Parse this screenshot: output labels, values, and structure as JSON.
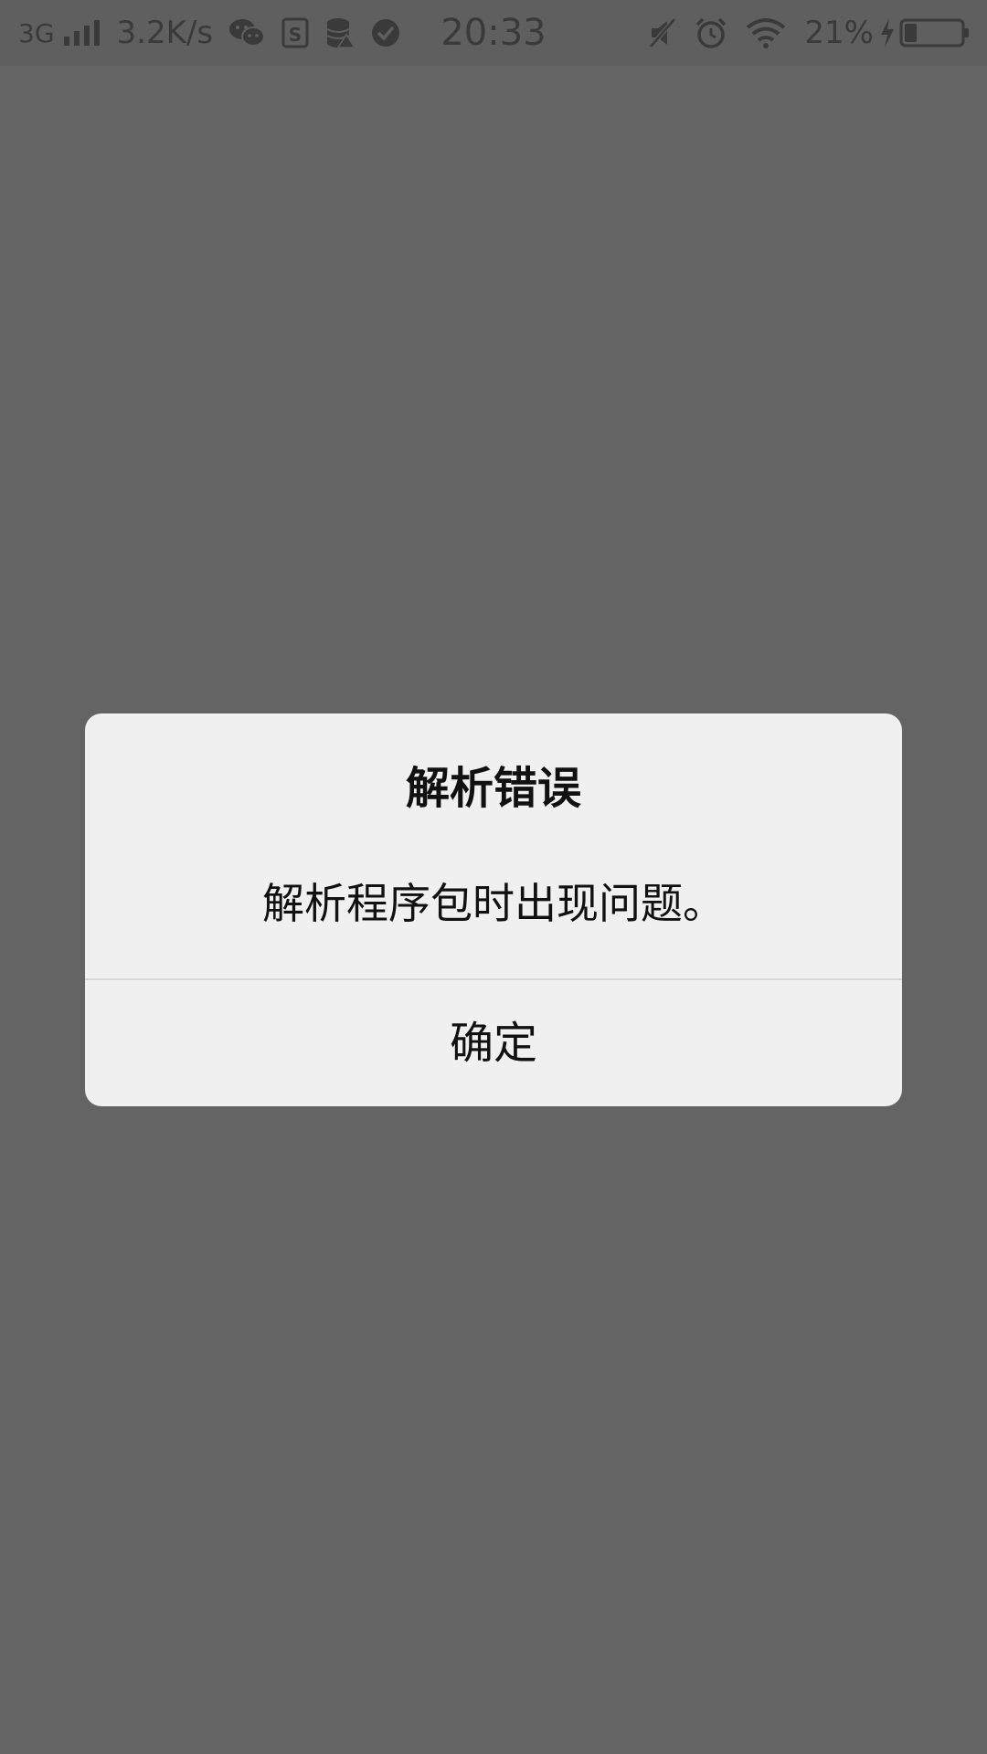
{
  "status_bar": {
    "network_type": "3G",
    "speed": "3.2K/s",
    "time": "20:33",
    "battery_percent": "21%",
    "battery_level": 0.21,
    "icons_left": [
      "signal-icon",
      "wechat-icon",
      "s-app-icon",
      "database-icon",
      "check-circle-icon"
    ],
    "icons_right": [
      "mute-icon",
      "alarm-icon",
      "wifi-icon",
      "charging-icon",
      "battery-icon"
    ]
  },
  "dialog": {
    "title": "解析错误",
    "message": "解析程序包时出现问题。",
    "confirm_label": "确定"
  },
  "colors": {
    "overlay": "#646464",
    "dialog_bg": "#f0f0f0",
    "text": "#111111",
    "status_icons": "#3a3a3a"
  }
}
